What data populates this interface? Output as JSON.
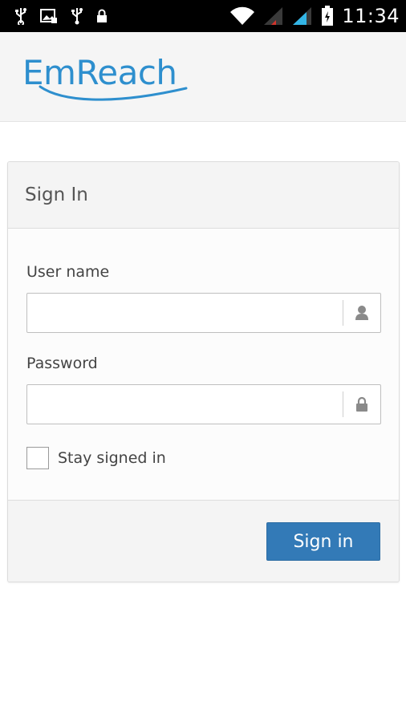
{
  "status_bar": {
    "time": "11:34",
    "icons": [
      "usb-icon",
      "image-icon",
      "usb-icon",
      "lock-icon",
      "wifi-icon",
      "signal-low-icon",
      "signal-icon",
      "battery-icon"
    ]
  },
  "header": {
    "logo_text": "EmReach",
    "brand_color": "#2e8fce"
  },
  "signin_card": {
    "title": "Sign In",
    "username": {
      "label": "User name",
      "value": "",
      "placeholder": "",
      "icon": "user-icon"
    },
    "password": {
      "label": "Password",
      "value": "",
      "placeholder": "",
      "icon": "lock-icon"
    },
    "stay_signed_in": {
      "label": "Stay signed in",
      "checked": false
    },
    "submit_label": "Sign in",
    "button_color": "#337ab7"
  }
}
